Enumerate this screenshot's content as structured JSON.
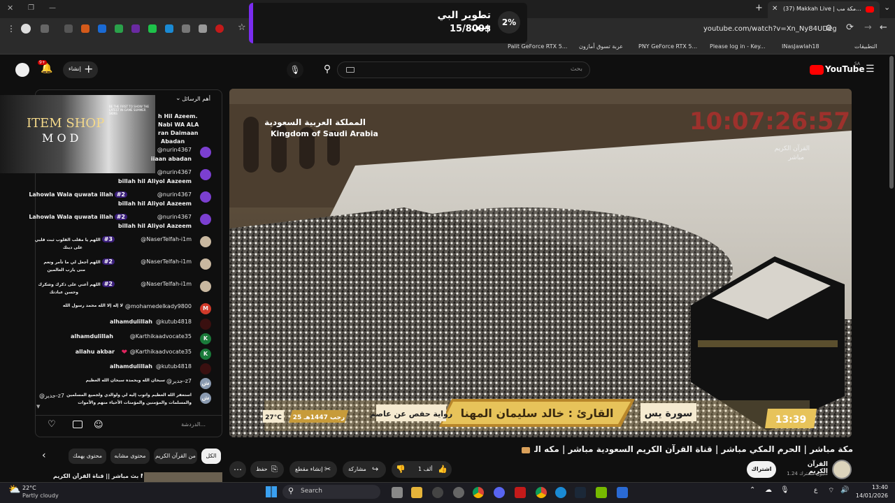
{
  "browser": {
    "tab_title": "(37) Makkah Live | مكة مب...",
    "url": "youtube.com/watch?v=Xn_Ny84UDeg",
    "bookmarks": [
      "التطبيقات",
      "INasJawlah18",
      "Please log in - Key...",
      "PNY GeForce RTX 5...",
      "عربة تسوق أمازون",
      "Palit GeForce RTX 5..."
    ]
  },
  "popup": {
    "percent": "2%",
    "title": "تطوير البي سي",
    "amount": "15/800$",
    "progress": 0.02,
    "accent": "#7a2cf0"
  },
  "youtube": {
    "logo": "YouTube",
    "region": "SA",
    "search_placeholder": "بحث",
    "create_label": "إنشاء",
    "notif_count": "9+"
  },
  "chat": {
    "header": "أهم الرسائل",
    "overlay_line1": "ITEM SHOP",
    "overlay_line2": "M O D",
    "overlay_tagline": "BE THE FIRST TO SHOW THE LATEST IN-GAME SUMMER SKINS",
    "partial_lines": [
      "h Hil Azeem.",
      "Nabi WA ALA",
      "ran Daimaan",
      "Abadan"
    ],
    "messages": [
      {
        "author": "@nurin4367",
        "text": "iiaan abadan",
        "badge": "",
        "avatar": "#7b3fd0"
      },
      {
        "author": "@nurin4367",
        "text": "billah hil Aliyol Aazeem",
        "badge": "",
        "avatar": "#7b3fd0"
      },
      {
        "author": "@nurin4367",
        "badge": "#2",
        "inline": "Lahowla Wala quwata illah",
        "text": "billah hil Aliyol Aazeem",
        "avatar": "#7b3fd0"
      },
      {
        "author": "@nurin4367",
        "badge": "#2",
        "inline": "Lahowla Wala quwata illah",
        "text": "billah hil Aliyol Aazeem",
        "avatar": "#7b3fd0"
      },
      {
        "author": "@NaserTelfah-i1m",
        "badge": "#3",
        "inline": "اللهم يا مقلب القلوب ثبت قلبي",
        "text": "على دينك",
        "avatar": "#c9b8a0"
      },
      {
        "author": "@NaserTelfah-i1m",
        "badge": "#2",
        "inline": "اللهم أجعل لي ما تأمر وتعم",
        "text": "منی يارب العالمين",
        "avatar": "#c9b8a0"
      },
      {
        "author": "@NaserTelfah-i1m",
        "badge": "#2",
        "inline": "اللهم أعني على ذكرك وشكرك",
        "text": "وحسن عبادتك",
        "avatar": "#c9b8a0"
      }
    ],
    "single_messages": [
      {
        "author": "@mohamedelkady9800",
        "text": "لا إله إلا الله محمد رسول الله",
        "avatar": "#d03a2a",
        "initial": "M"
      },
      {
        "author": "@kutub4818",
        "text": "alhamdulillah",
        "avatar": "#3a1010",
        "initial": ""
      },
      {
        "author": "@Karthikaadvocate35",
        "text": "alhamdulillah",
        "avatar": "#1a7a3a",
        "initial": "K"
      },
      {
        "author": "@Karthikaadvocate35",
        "text": "allahu akbar",
        "avatar": "#1a7a3a",
        "initial": "K"
      },
      {
        "author": "@kutub4818",
        "text": "alhamdulillah",
        "avatar": "#3a1010",
        "initial": ""
      },
      {
        "author": "@جدير-z7",
        "text": "سبحان الله وبحمده سبحان الله العظيم",
        "avatar": "#8a9ab0",
        "initial": "ش"
      }
    ],
    "last_message": {
      "author": "@جدير-z7",
      "line1": "استغفر الله العظيم واتوب إليه لي ولوالدي ولجميع المسلمين",
      "line2": "والمسلمات والمؤمنين والمؤمنات الأحياء منهم والأموات",
      "avatar": "#8a9ab0",
      "initial": "ش"
    },
    "input_placeholder": "الدردشة..."
  },
  "video": {
    "watermark_ar": "المملكة العربية السعودية",
    "watermark_en": "Kingdom of Saudi Arabia",
    "clock": "10:07:26:57",
    "clock_label": "القرآن الكريم",
    "live_label": "مباشر",
    "surah": "سورة يس",
    "reciter": "القارئ : خالد سليمان المهنا",
    "narration": "رواية حفص عن عاصم",
    "date": "25 رجب 1447هـ",
    "temp": "27°C",
    "time": "13:39"
  },
  "meta": {
    "title": "مكة مباشر | الحرم المكي مباشر | قناة القرآن الكريم السعودية مباشر | مكه المكرمه مبا | Makkah Live",
    "channel": "القرآن الكريم",
    "subscribers": "1.24 مليون مشترك",
    "subscribe": "اشتراك",
    "likes": "1 ألف",
    "share": "مشاركة",
    "clip": "إنشاء مقطع",
    "save": "حفظ",
    "chips": [
      "الكل",
      "من القرآن الكريم",
      "محتوى مشابه",
      "محتوى يهمك"
    ],
    "next_title": "بث مباشر || قناة القرآن الكريم Makkah"
  },
  "taskbar": {
    "weather_temp": "22°C",
    "weather_desc": "Partly cloudy",
    "search": "Search",
    "time": "13:40",
    "date": "14/01/2026"
  }
}
